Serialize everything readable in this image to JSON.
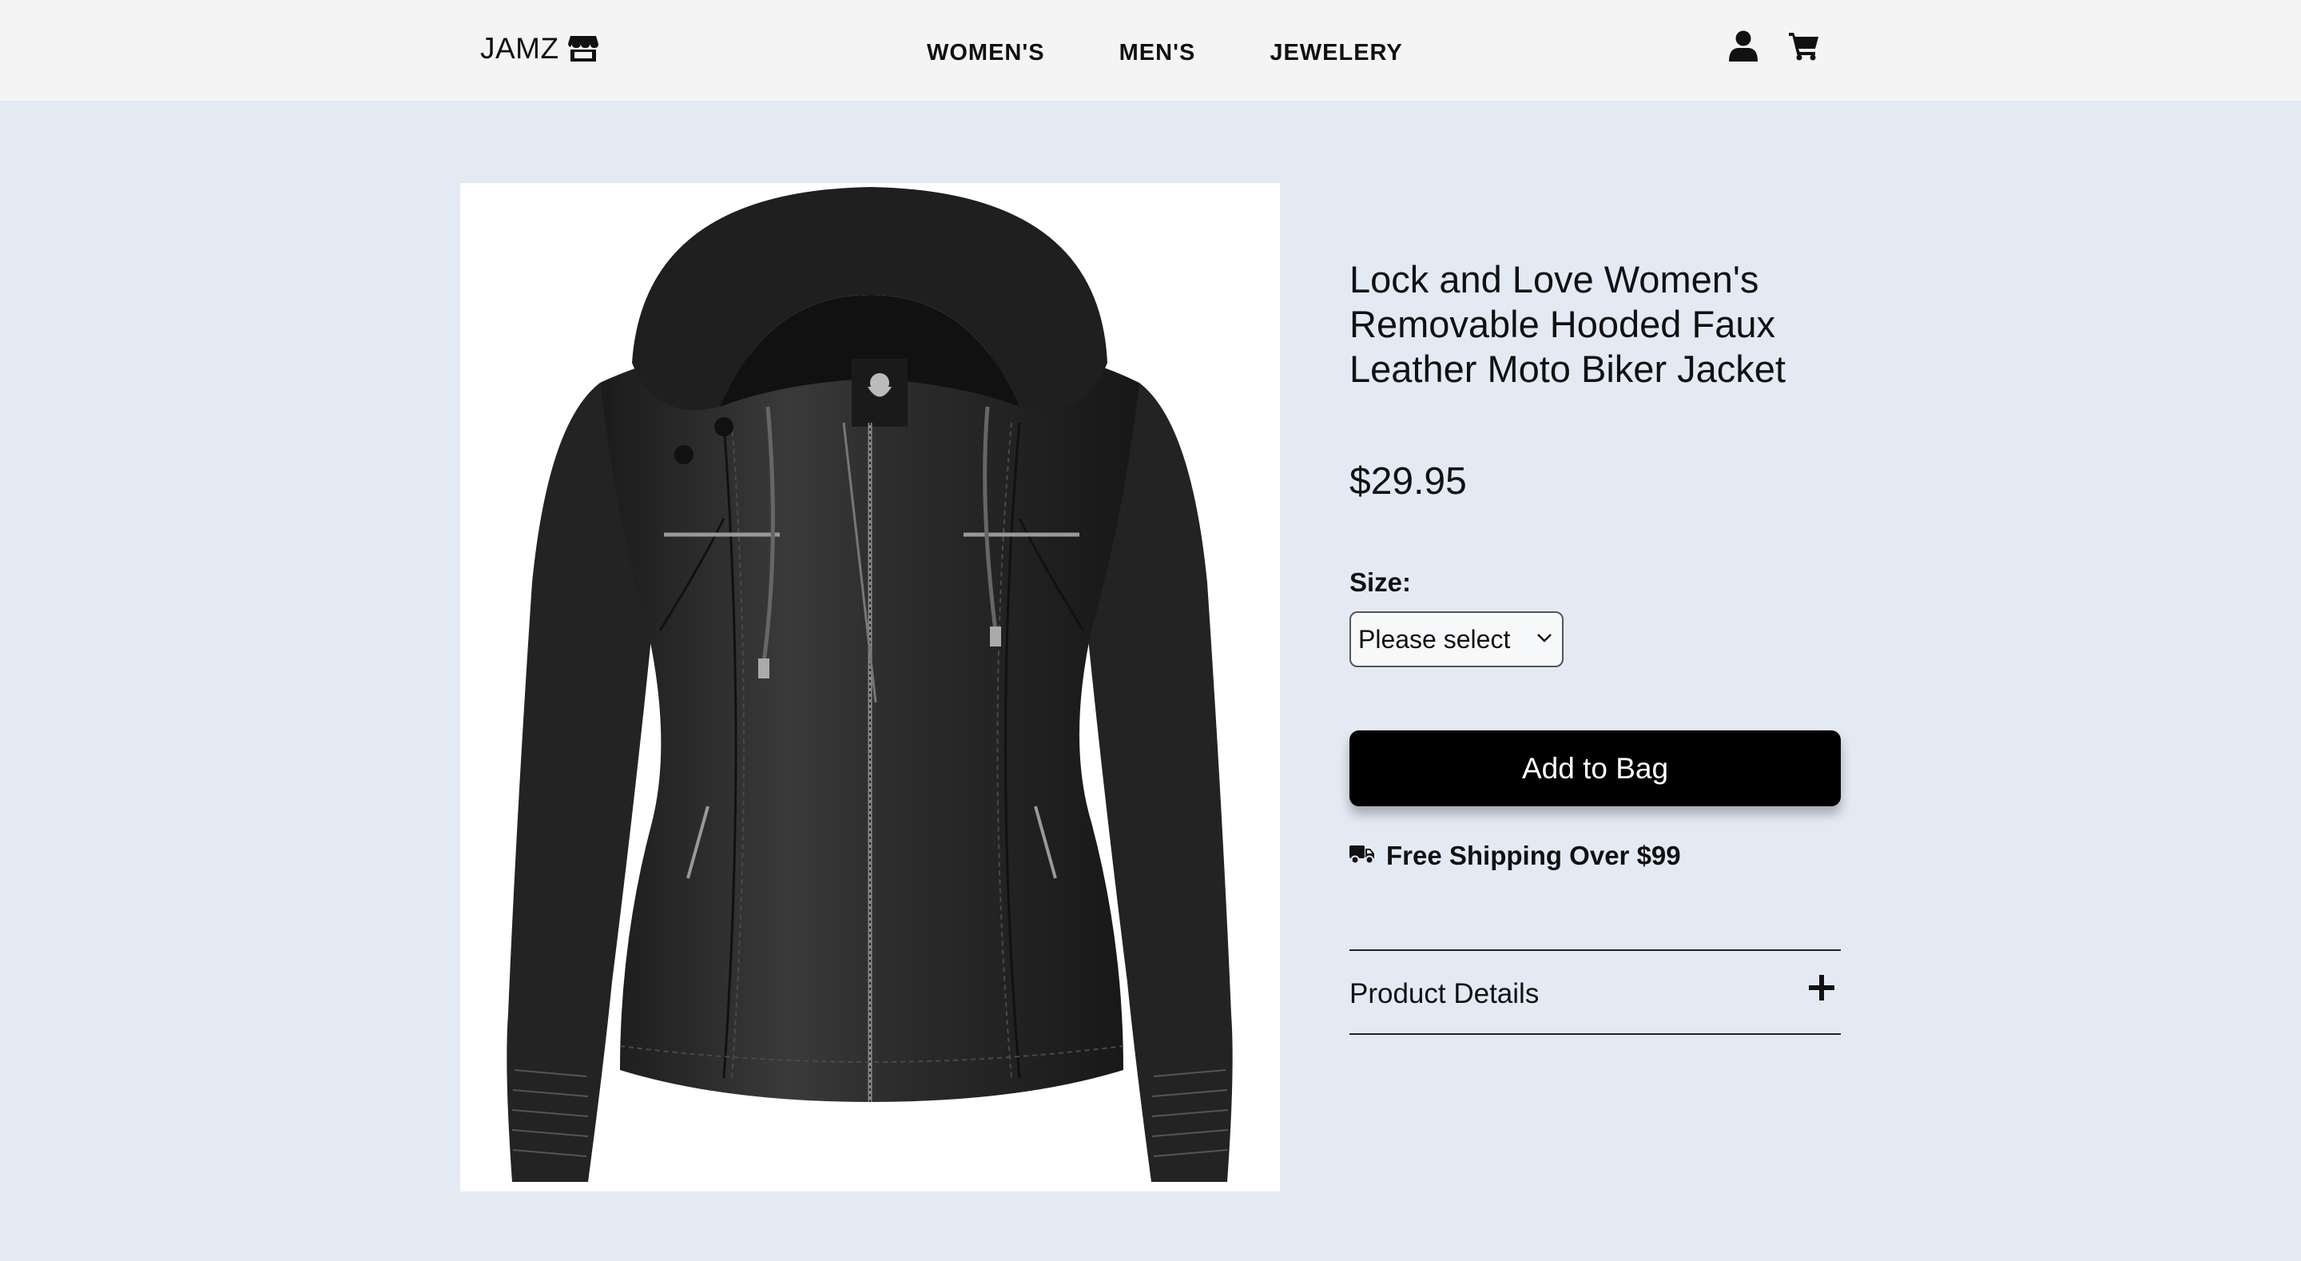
{
  "header": {
    "logo_text": "JAMZ",
    "logo_icon": "store-icon",
    "nav": [
      {
        "label": "WOMEN'S"
      },
      {
        "label": "MEN'S"
      },
      {
        "label": "JEWELERY"
      }
    ],
    "icons": [
      "user-icon",
      "cart-icon"
    ]
  },
  "product": {
    "image_alt_icon": "jacket-image",
    "title": "Lock and Love Women's Removable Hooded Faux Leather Moto Biker Jacket",
    "price": "$29.95",
    "size_label": "Size:",
    "size_select": {
      "selected": "Please select"
    },
    "add_button": "Add to Bag",
    "shipping_icon": "truck-icon",
    "shipping_text": "Free Shipping Over $99",
    "details_label": "Product Details",
    "details_icon": "plus-icon"
  },
  "colors": {
    "page_bg": "#e4eaf4",
    "header_bg": "#f4f4f4",
    "button_bg": "#000000",
    "button_text": "#ffffff"
  }
}
